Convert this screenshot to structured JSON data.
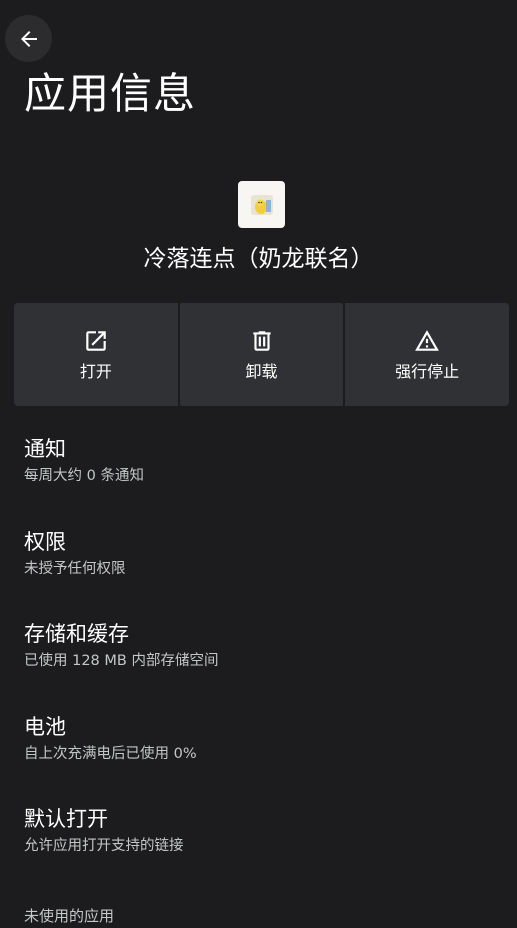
{
  "header": {
    "title": "应用信息",
    "back_icon": "arrow-back-icon"
  },
  "app": {
    "name": "冷落连点（奶龙联名）",
    "icon": "app-icon"
  },
  "actions": [
    {
      "label": "打开",
      "icon": "open-external-icon"
    },
    {
      "label": "卸载",
      "icon": "trash-icon"
    },
    {
      "label": "强行停止",
      "icon": "warning-triangle-icon"
    }
  ],
  "settings": [
    {
      "title": "通知",
      "summary": "每周大约 0 条通知"
    },
    {
      "title": "权限",
      "summary": "未授予任何权限"
    },
    {
      "title": "存储和缓存",
      "summary": "已使用 128 MB 内部存储空间"
    },
    {
      "title": "电池",
      "summary": "自上次充满电后已使用 0%"
    },
    {
      "title": "默认打开",
      "summary": "允许应用打开支持的链接"
    }
  ],
  "section": {
    "unused_apps_header": "未使用的应用"
  },
  "colors": {
    "background": "#1c1c1e",
    "button_surface": "#303134",
    "text_primary": "#ffffff",
    "text_secondary": "#c4c7c5"
  }
}
